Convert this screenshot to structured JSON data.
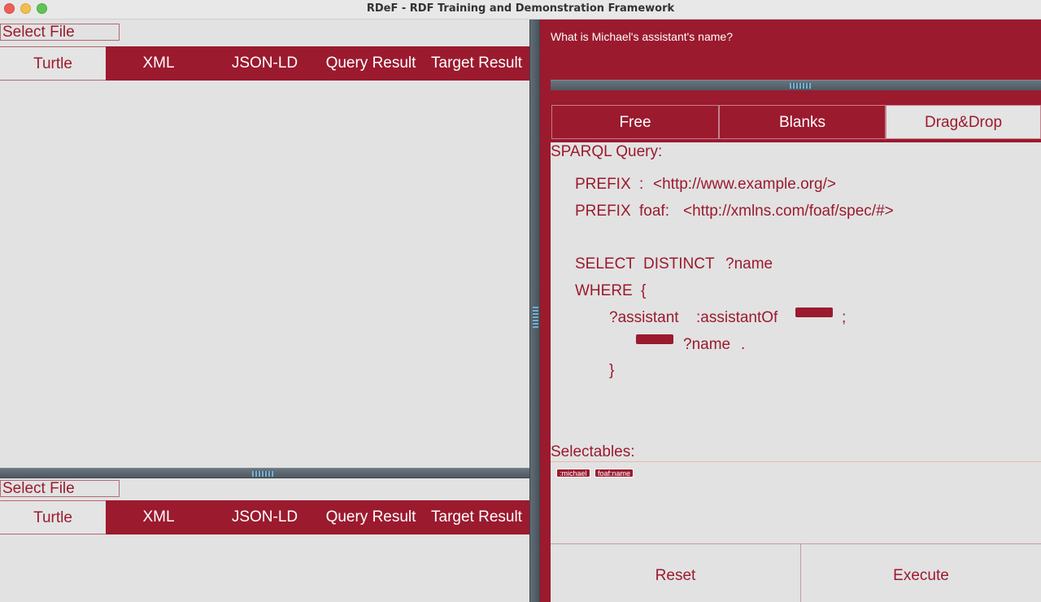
{
  "window": {
    "title": "RDeF - RDF Training and Demonstration Framework"
  },
  "top_pane": {
    "select_file": "Select File",
    "tabs": [
      "Turtle",
      "XML",
      "JSON-LD",
      "Query Result",
      "Target Result"
    ],
    "active_tab": "Turtle"
  },
  "bottom_pane": {
    "select_file": "Select File",
    "tabs": [
      "Turtle",
      "XML",
      "JSON-LD",
      "Query Result",
      "Target Result"
    ],
    "active_tab": "Turtle"
  },
  "question": "What is Michael's assistant's name?",
  "modes": {
    "tabs": [
      "Free",
      "Blanks",
      "Drag&Drop"
    ],
    "active": "Drag&Drop"
  },
  "query": {
    "label": "SPARQL Query:",
    "prefix1_kw": "PREFIX",
    "prefix1_ns": ":",
    "prefix1_iri": "<http://www.example.org/>",
    "prefix2_kw": "PREFIX",
    "prefix2_ns": "foaf:",
    "prefix2_iri": "<http://xmlns.com/foaf/spec/#>",
    "select_kw": "SELECT",
    "distinct_kw": "DISTINCT",
    "select_var": "?name",
    "where_kw": "WHERE",
    "open_brace": "{",
    "triple1_subject": "?assistant",
    "triple1_predicate": ":assistantOf",
    "triple1_end": ";",
    "triple2_object": "?name",
    "triple2_end": ".",
    "close_brace": "}"
  },
  "selectables": {
    "label": "Selectables:",
    "items": [
      ":michael",
      "foaf:name"
    ]
  },
  "buttons": {
    "reset": "Reset",
    "execute": "Execute"
  },
  "colors": {
    "accent": "#9b1a2e",
    "background": "#e2e2e2"
  }
}
